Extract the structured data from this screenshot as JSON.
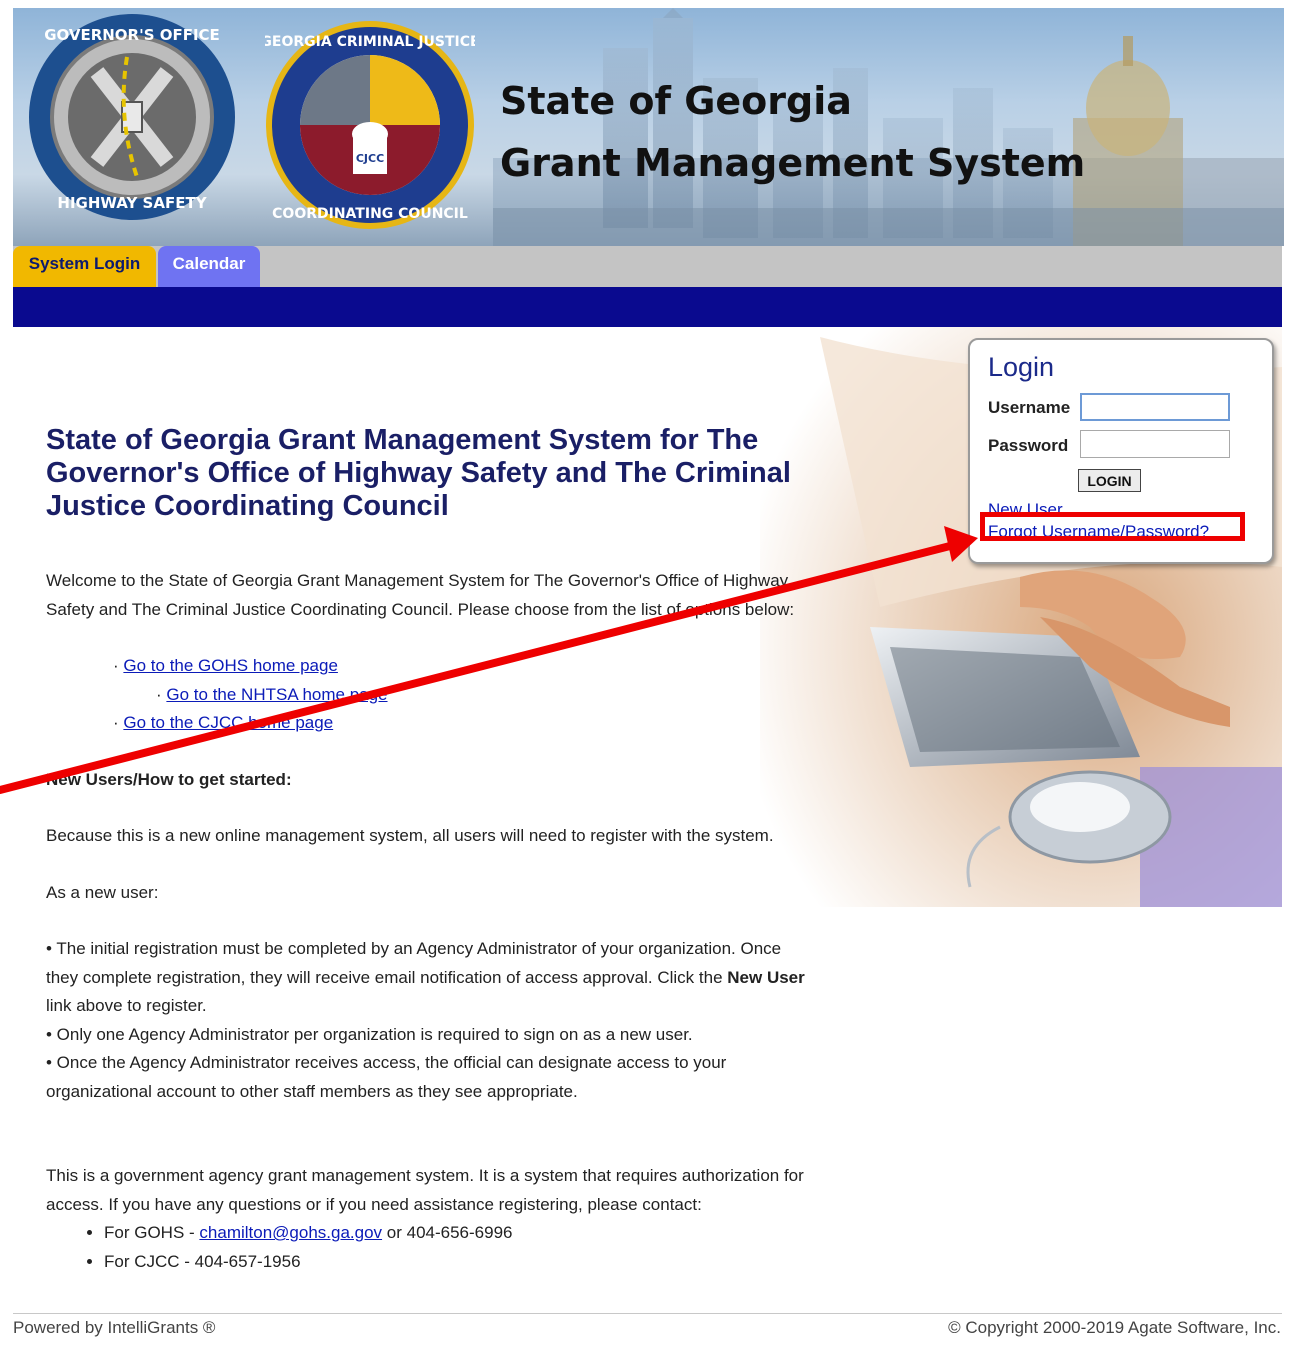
{
  "header": {
    "title_line1": "State of Georgia",
    "title_line2": "Grant Management System",
    "seal_left_text": "GOVERNOR'S OFFICE OF HIGHWAY SAFETY",
    "seal_right_text": "GEORGIA CRIMINAL JUSTICE COORDINATING COUNCIL",
    "seal_right_abbrev": "CJCC"
  },
  "tabs": [
    {
      "label": "System Login",
      "color": "#f1b800"
    },
    {
      "label": "Calendar",
      "color": "#6f73f2"
    }
  ],
  "login": {
    "title": "Login",
    "username_label": "Username",
    "password_label": "Password",
    "username_value": "",
    "password_value": "",
    "button_label": "LOGIN",
    "new_user_link": "New User",
    "forgot_link": "Forgot Username/Password?"
  },
  "content": {
    "heading": "State of Georgia Grant Management System for The Governor's Office of Highway Safety and The Criminal Justice Coordinating Council",
    "welcome": "Welcome to the State of Georgia Grant Management System for The Governor's Office of Highway Safety and The Criminal Justice Coordinating Council. Please choose from the list of options below:",
    "links": [
      "Go to the GOHS home page",
      "Go to the NHTSA home page",
      "Go to the CJCC home page"
    ],
    "new_users_heading": "New Users/How to get started:",
    "register_note": "Because this is a new online management system, all users will need to register with the system.",
    "as_new_user": "As a new user:",
    "bullet1_pre": "• The initial registration must be completed by an Agency Administrator of your organization. Once they complete registration, they will receive email notification of access approval. Click the ",
    "bullet1_bold": "New User",
    "bullet1_post": " link above to register.",
    "bullet2": "• Only one Agency Administrator per organization is required to sign on as a new user.",
    "bullet3": "• Once the Agency Administrator receives access, the official can designate access to your organizational account to other staff members as they see appropriate.",
    "gov_notice": "This is a government agency grant management system. It is a system that requires authorization for access. If you have any questions or if you need assistance registering, please contact:",
    "contact_gohs_pre": "For GOHS - ",
    "contact_gohs_email": "chamilton@gohs.ga.gov",
    "contact_gohs_post": " or 404-656-6996",
    "contact_cjcc": "For CJCC - 404-657-1956"
  },
  "footer": {
    "left": "Powered by IntelliGrants ®",
    "right": "© Copyright 2000-2019 Agate Software, Inc."
  },
  "colors": {
    "nav_blue": "#0a0a8f",
    "heading_navy": "#1a1f66",
    "link_blue": "#0b1bb8",
    "annotation_red": "#ee0000"
  }
}
